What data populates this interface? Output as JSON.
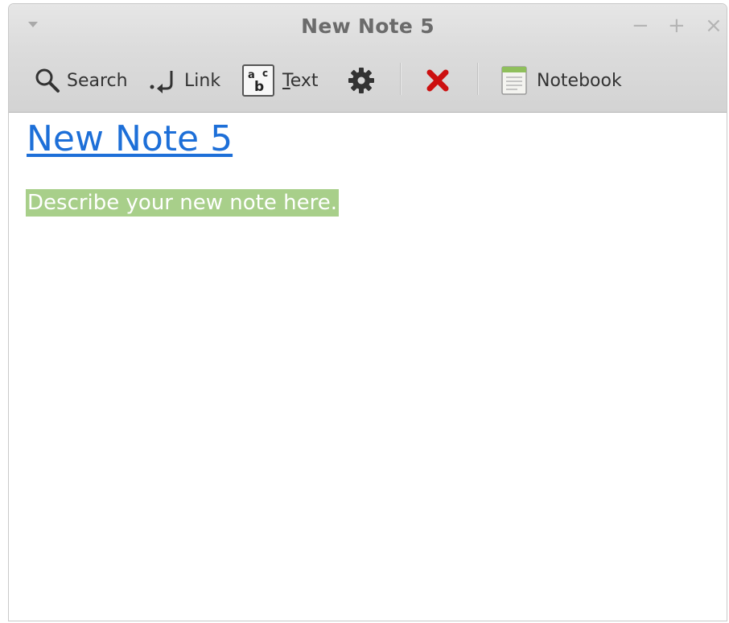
{
  "window": {
    "title": "New Note 5",
    "controls": {
      "minimize": "−",
      "maximize": "+",
      "close": "×"
    }
  },
  "toolbar": {
    "search_label": "Search",
    "link_label": "Link",
    "text_label_first": "T",
    "text_label_rest": "ext",
    "notebook_label": "Notebook"
  },
  "note": {
    "title": "New Note 5",
    "body": "Describe your new note here."
  },
  "colors": {
    "link": "#1d6fd8",
    "highlight": "#a8cf8a",
    "delete": "#cc1010"
  },
  "icons": [
    "window-menu-icon",
    "search-icon",
    "link-icon",
    "text-style-icon",
    "gear-icon",
    "delete-icon",
    "notebook-icon"
  ]
}
